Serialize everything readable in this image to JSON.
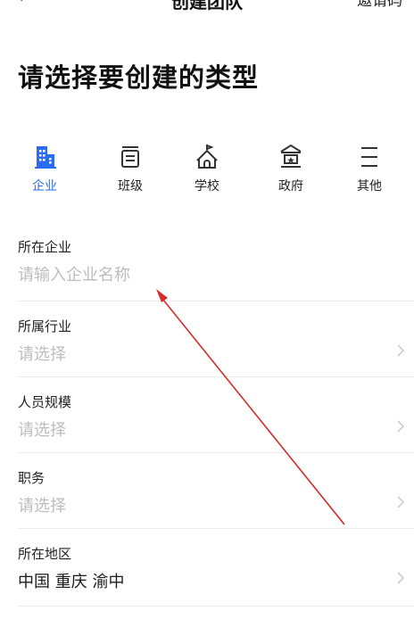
{
  "topbar": {
    "back": "‹",
    "title": "创建团队",
    "right": "邀请码"
  },
  "page_title": "请选择要创建的类型",
  "types": [
    {
      "label": "企业",
      "icon": "building-icon",
      "active": true
    },
    {
      "label": "班级",
      "icon": "class-board-icon",
      "active": false
    },
    {
      "label": "学校",
      "icon": "school-icon",
      "active": false
    },
    {
      "label": "政府",
      "icon": "government-icon",
      "active": false
    },
    {
      "label": "其他",
      "icon": "menu-icon",
      "active": false
    }
  ],
  "form": {
    "company": {
      "label": "所在企业",
      "placeholder": "请输入企业名称"
    },
    "industry": {
      "label": "所属行业",
      "placeholder": "请选择"
    },
    "size": {
      "label": "人员规模",
      "placeholder": "请选择"
    },
    "position": {
      "label": "职务",
      "placeholder": "请选择"
    },
    "region": {
      "label": "所在地区",
      "value": "中国 重庆 渝中"
    }
  },
  "colors": {
    "accent": "#2a6df4",
    "annotation_arrow": "#d62b2b",
    "placeholder": "#bdbdbd"
  }
}
